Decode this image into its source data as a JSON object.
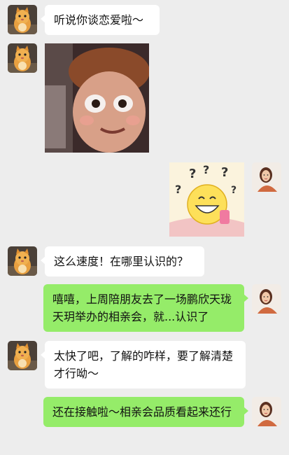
{
  "chat": {
    "messages": [
      {
        "side": "left",
        "type": "text",
        "sender": "cat-avatar",
        "text": "听说你谈恋爱啦～"
      },
      {
        "side": "left",
        "type": "image",
        "sender": "cat-avatar",
        "image": "surprised-boy-face-sticker"
      },
      {
        "side": "right",
        "type": "image",
        "sender": "woman-avatar",
        "image": "confused-smiling-emoji-sticker"
      },
      {
        "side": "left",
        "type": "text",
        "sender": "cat-avatar",
        "text": "这么速度！在哪里认识的？"
      },
      {
        "side": "right",
        "type": "text",
        "sender": "woman-avatar",
        "text": "嘻嘻，上周陪朋友去了一场鹏欣天珑天玥举办的相亲会，就...认识了"
      },
      {
        "side": "left",
        "type": "text",
        "sender": "cat-avatar",
        "text": "太快了吧，了解的咋样，要了解清楚才行呦～"
      },
      {
        "side": "right",
        "type": "text",
        "sender": "woman-avatar",
        "text": "还在接触啦～相亲会品质看起来还行"
      }
    ]
  },
  "colors": {
    "background": "#ededed",
    "bubble_left": "#ffffff",
    "bubble_right": "#95ec69"
  }
}
